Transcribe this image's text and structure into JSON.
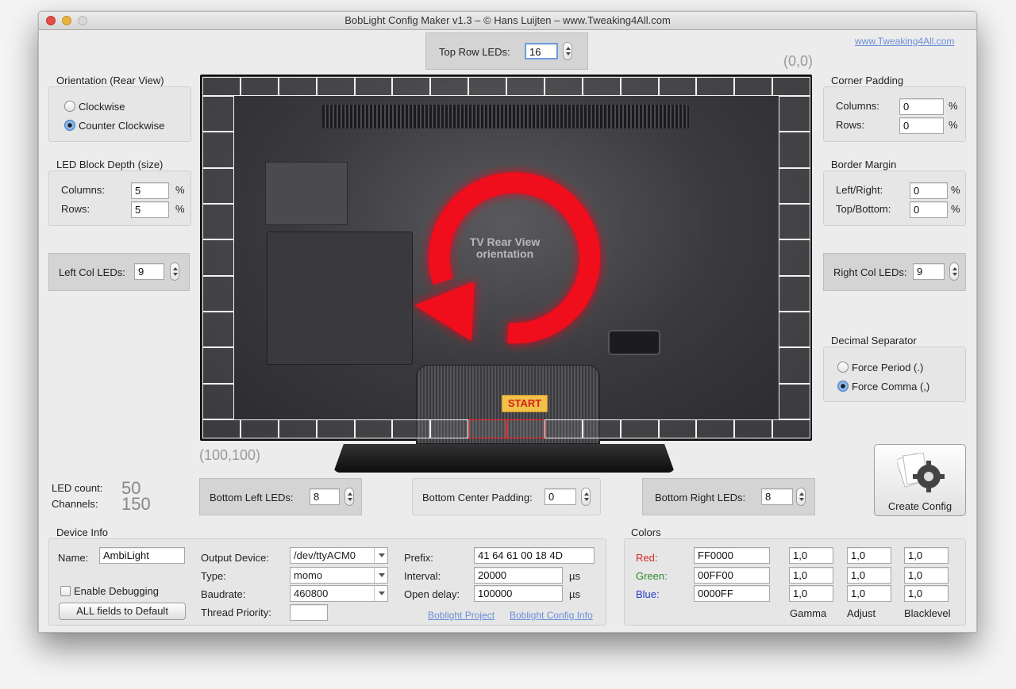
{
  "window": {
    "title": "BobLight Config Maker v1.3 – © Hans Luijten – www.Tweaking4All.com"
  },
  "header": {
    "site_link": "www.Tweaking4All.com"
  },
  "top_row": {
    "label": "Top Row LEDs:",
    "value": "16"
  },
  "coords": {
    "origin": "(0,0)",
    "end": "(100,100)"
  },
  "orientation": {
    "title": "Orientation (Rear View)",
    "options": [
      {
        "label": "Clockwise",
        "selected": false
      },
      {
        "label": "Counter Clockwise",
        "selected": true
      }
    ]
  },
  "led_depth": {
    "title": "LED Block Depth (size)",
    "columns_label": "Columns:",
    "columns_value": "5",
    "rows_label": "Rows:",
    "rows_value": "5",
    "unit": "%"
  },
  "left_col": {
    "label": "Left Col LEDs:",
    "value": "9"
  },
  "right_col": {
    "label": "Right Col LEDs:",
    "value": "9"
  },
  "corner_padding": {
    "title": "Corner Padding",
    "columns_label": "Columns:",
    "columns_value": "0",
    "rows_label": "Rows:",
    "rows_value": "0",
    "unit": "%"
  },
  "border_margin": {
    "title": "Border Margin",
    "lr_label": "Left/Right:",
    "lr_value": "0",
    "tb_label": "Top/Bottom:",
    "tb_value": "0",
    "unit": "%"
  },
  "decimal": {
    "title": "Decimal Separator",
    "options": [
      {
        "label": "Force Period (.)",
        "selected": false
      },
      {
        "label": "Force Comma (,)",
        "selected": true
      }
    ]
  },
  "tv": {
    "caption_line1": "TV Rear View",
    "caption_line2": "orientation",
    "start": "START"
  },
  "counts": {
    "led_label": "LED count:",
    "led_value": "50",
    "channels_label": "Channels:",
    "channels_value": "150"
  },
  "bottom_left": {
    "label": "Bottom Left LEDs:",
    "value": "8"
  },
  "bottom_center": {
    "label": "Bottom Center Padding:",
    "value": "0"
  },
  "bottom_right": {
    "label": "Bottom Right LEDs:",
    "value": "8"
  },
  "create_config": {
    "label": "Create Config"
  },
  "device_info": {
    "title": "Device Info",
    "name_label": "Name:",
    "name_value": "AmbiLight",
    "debug_label": "Enable Debugging",
    "default_button": "ALL fields to Default",
    "output_label": "Output Device:",
    "output_value": "/dev/ttyACM0",
    "type_label": "Type:",
    "type_value": "momo",
    "baud_label": "Baudrate:",
    "baud_value": "460800",
    "priority_label": "Thread Priority:",
    "priority_value": "",
    "prefix_label": "Prefix:",
    "prefix_value": "41 64 61 00 18 4D",
    "interval_label": "Interval:",
    "interval_value": "20000",
    "delay_label": "Open delay:",
    "delay_value": "100000",
    "us_unit": "µs",
    "link1": "Boblight Project",
    "link2": "Boblight Config Info"
  },
  "colors": {
    "title": "Colors",
    "rows": [
      {
        "label": "Red:",
        "color": "#d62a1f",
        "hex": "FF0000",
        "gamma": "1,0",
        "adjust": "1,0",
        "black": "1,0"
      },
      {
        "label": "Green:",
        "color": "#2f8a2f",
        "hex": "00FF00",
        "gamma": "1,0",
        "adjust": "1,0",
        "black": "1,0"
      },
      {
        "label": "Blue:",
        "color": "#2a3fc9",
        "hex": "0000FF",
        "gamma": "1,0",
        "adjust": "1,0",
        "black": "1,0"
      }
    ],
    "gamma_label": "Gamma",
    "adjust_label": "Adjust",
    "black_label": "Blacklevel"
  }
}
